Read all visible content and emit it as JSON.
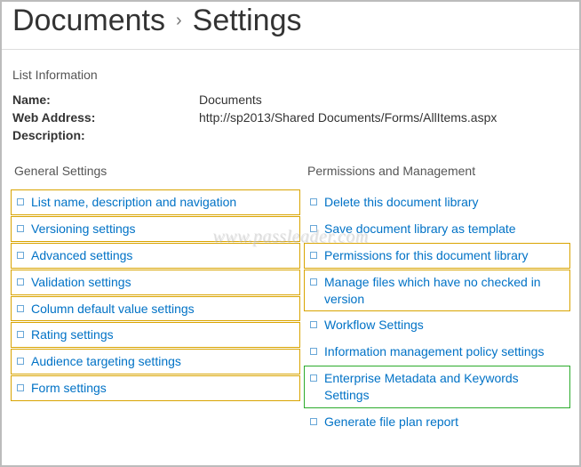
{
  "breadcrumb": {
    "root": "Documents",
    "current": "Settings"
  },
  "list_info": {
    "heading": "List Information",
    "rows": {
      "name_label": "Name:",
      "name_value": "Documents",
      "web_label": "Web Address:",
      "web_value": "http://sp2013/Shared Documents/Forms/AllItems.aspx",
      "desc_label": "Description:",
      "desc_value": ""
    }
  },
  "columns": {
    "general": {
      "header": "General Settings",
      "items": [
        {
          "label": "List name, description and navigation",
          "hl": "amber"
        },
        {
          "label": "Versioning settings",
          "hl": "amber"
        },
        {
          "label": "Advanced settings",
          "hl": "amber"
        },
        {
          "label": "Validation settings",
          "hl": "amber"
        },
        {
          "label": "Column default value settings",
          "hl": "amber"
        },
        {
          "label": "Rating settings",
          "hl": "amber"
        },
        {
          "label": "Audience targeting settings",
          "hl": "amber"
        },
        {
          "label": "Form settings",
          "hl": "amber"
        }
      ]
    },
    "perms": {
      "header": "Permissions and Management",
      "items": [
        {
          "label": "Delete this document library",
          "hl": "none"
        },
        {
          "label": "Save document library as template",
          "hl": "none"
        },
        {
          "label": "Permissions for this document library",
          "hl": "amber"
        },
        {
          "label": "Manage files which have no checked in version",
          "hl": "amber"
        },
        {
          "label": "Workflow Settings",
          "hl": "none"
        },
        {
          "label": "Information management policy settings",
          "hl": "none"
        },
        {
          "label": "Enterprise Metadata and Keywords Settings",
          "hl": "green"
        },
        {
          "label": "Generate file plan report",
          "hl": "none"
        }
      ]
    }
  },
  "watermark": "www.passleader.com"
}
